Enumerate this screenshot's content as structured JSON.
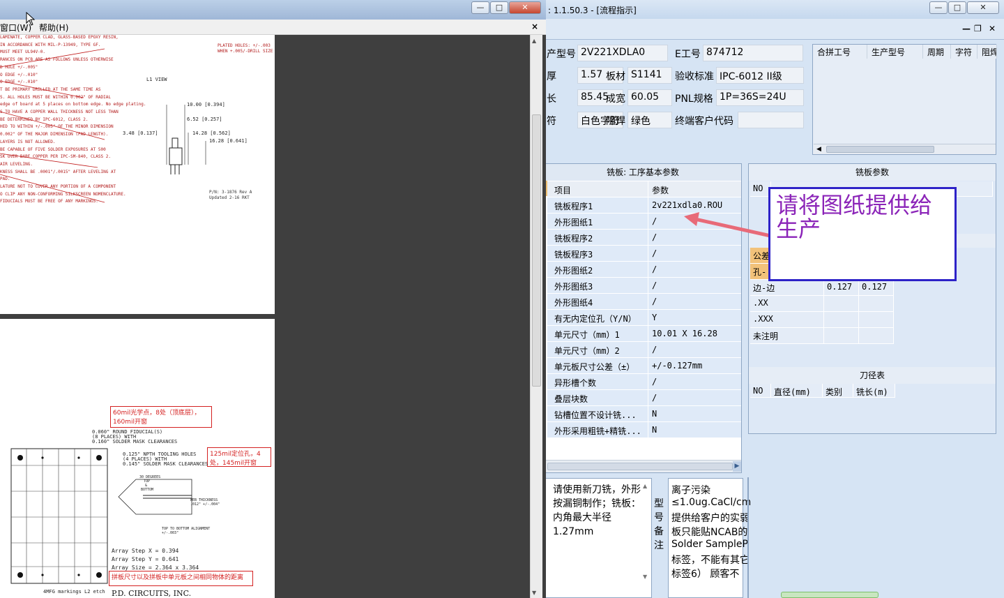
{
  "pdf": {
    "menu_window": "窗口(W)",
    "menu_help": "帮助(H)",
    "close_glyph": "×",
    "page1_notes": [
      "LAMINATE, COPPER CLAD, GLASS-BASED EPOXY RESIN,",
      "IN ACCORDANCE WITH MIL-P-13949, TYPE GF.",
      "MUST MEET UL94V-0.",
      "RANCES ON PCB ARE AS FOLLOWS UNLESS OTHERWISE",
      "D HOLE +/-.005\"",
      "O EDGE +/-.010\"",
      "O EDGE +/-.010\"",
      "T BE PRIMARY DRILLED AT THE SAME TIME AS",
      "S. ALL HOLES MUST BE WITHIN 0.002\" OF RADIAL",
      "edge of board at 5 places on bottom edge. No edge plating.",
      "S TO HAVE A COPPER WALL THICKNESS NOT LESS THAN",
      "BE DETERMINED BY IPC-6012, CLASS 2.",
      "HED TO WITHIN +/-.005\" OF THE MINOR DIMENSION",
      "0.002\" OF THE MAJOR DIMENSION (PAD LENGTH).",
      "LAYERS IS NOT ALLOWED.",
      "BE CAPABLE OF FIVE SOLDER EXPOSURES AT 500",
      "SK OVER BARE COPPER PER IPC-SM-840, CLASS 2.",
      "AIR LEVELING.",
      "KNESS SHALL BE .0001\"/.0015\" AFTER LEVELING AT",
      "PAD.",
      "LATURE NOT TO COVER ANY PORTION OF A COMPONENT",
      "O CLIP ANY NON-CONFORMING SILKSCREEN NOMENCLATURE.",
      "FIDUCIALS MUST BE FREE OF ANY MARKINGS."
    ],
    "page1_view_label": "L1 VIEW",
    "page1_dims": [
      "10.00 [0.394]",
      "6.52 [0.257]",
      "3.48 [0.137]",
      "14.28 [0.562]",
      "16.28 [0.641]"
    ],
    "page1_right_notes": [
      "PLATED HOLES: +/-.003",
      "WHEN +.005/-DRILL SIZE"
    ],
    "page1_part": "P/N: 3-1876 Rev A",
    "page1_updated": "Updated 2-16 RKT",
    "page2_callouts": [
      "60mil光学点，8处（顶底层），160mil开窗",
      "125mil定位孔，4处，145mil开窗",
      "拼板尺寸以及拼板中单元板之间相同物体的距离"
    ],
    "page2_notes": [
      "0.060\" ROUND FIDUCIAL(S)",
      "(8 PLACES) WITH",
      "0.160\" SOLDER MASK CLEARANCES",
      "0.125\" NPTH TOOLING HOLES",
      "(4 PLACES) WITH",
      "0.145\" SOLDER MASK CLEARANCES"
    ],
    "page2_bevel": [
      "30 DEGREES",
      "TOP",
      "&",
      "BOTTOM",
      "WEB THICKNESS",
      ".012\" +/-.004\"",
      "TOP TO BOTTOM ALIGNMENT",
      "+/-.003\""
    ],
    "page2_array": [
      "Array Step X = 0.394",
      "Array Step Y = 0.641",
      "Array Size = 2.364 x 3.364"
    ],
    "page2_bottom": "4MFG markings L2 etch",
    "page2_company": "P.D. CIRCUITS, INC."
  },
  "mes": {
    "title": ": 1.1.50.3 - [流程指示]",
    "fields": {
      "product_no_label": "产型号",
      "product_no": "2V221XDLA0",
      "e_no_label": "E工号",
      "e_no": "874712",
      "thickness_label": "厚",
      "thickness": "1.57",
      "material_label": "板材",
      "material": "S1141",
      "accept_label": "验收标准",
      "accept": "IPC-6012 II级",
      "length_label": "长",
      "length": "85.45",
      "finish_w_label": "成宽",
      "finish_w": "60.05",
      "pnl_label": "PNL规格",
      "pnl": "1P=36S=24U",
      "char_label": "符",
      "char": "白色字符",
      "mask_label": "阻焊",
      "mask": "绿色",
      "cust_label": "终端客户代码",
      "cust": ""
    },
    "plate_headers": [
      "合拼工号",
      "生产型号",
      "周期",
      "字符",
      "阻焊"
    ],
    "mill_panel": {
      "title": "铣板: 工序基本参数",
      "col_item": "项目",
      "col_param": "参数",
      "rows": [
        {
          "item": "铣板程序1",
          "param": "2v221xdla0.ROU"
        },
        {
          "item": "外形图纸1",
          "param": "/"
        },
        {
          "item": "铣板程序2",
          "param": "/"
        },
        {
          "item": "铣板程序3",
          "param": "/"
        },
        {
          "item": "外形图纸2",
          "param": "/"
        },
        {
          "item": "外形图纸3",
          "param": "/"
        },
        {
          "item": "外形图纸4",
          "param": "/"
        },
        {
          "item": "有无内定位孔（Y/N）",
          "param": "Y"
        },
        {
          "item": "单元尺寸（mm）1",
          "param": "10.01 X 16.28"
        },
        {
          "item": "单元尺寸（mm）2",
          "param": "/"
        },
        {
          "item": "单元板尺寸公差（±）",
          "param": "+/-0.127mm"
        },
        {
          "item": "异形槽个数",
          "param": "/"
        },
        {
          "item": "叠层块数",
          "param": "/"
        },
        {
          "item": "钻槽位置不设计铣...",
          "param": "N"
        },
        {
          "item": "外形采用粗铣+精铣...",
          "param": "N"
        }
      ]
    },
    "mp_panel": {
      "title": "铣板参数",
      "no_col": "NO",
      "tol_title": "公差",
      "tol_rows": [
        {
          "label": "公差",
          "a": "",
          "b": ""
        },
        {
          "label": "孔-",
          "a": "",
          "b": ""
        },
        {
          "label": "边-边",
          "a": "0.127",
          "b": "0.127"
        },
        {
          "label": ".XX",
          "a": "",
          "b": ""
        },
        {
          "label": ".XXX",
          "a": "",
          "b": ""
        },
        {
          "label": "未注明",
          "a": "",
          "b": ""
        }
      ],
      "knife_title": "刀径表",
      "knife_headers": [
        "NO",
        "直径(mm)",
        "类别",
        "铣长(m)"
      ]
    },
    "note_left": "请使用新刀铣，外形按漏铜制作；铣板：内角最大半径1.27mm",
    "note_mid_label": "型号备注",
    "note_right": [
      "离子污染",
      "≤1.0ug.CaCl/cm",
      "提供给客户的实弱",
      "板只能贴NCAB的",
      "Solder SampleP",
      "标签，不能有其它",
      "标签6）  顾客不"
    ]
  },
  "callout": {
    "text": "请将图纸提供给生产",
    "accent": "#2d22c8",
    "text_color": "#8b24b8",
    "arrow_color": "#e86a78"
  }
}
